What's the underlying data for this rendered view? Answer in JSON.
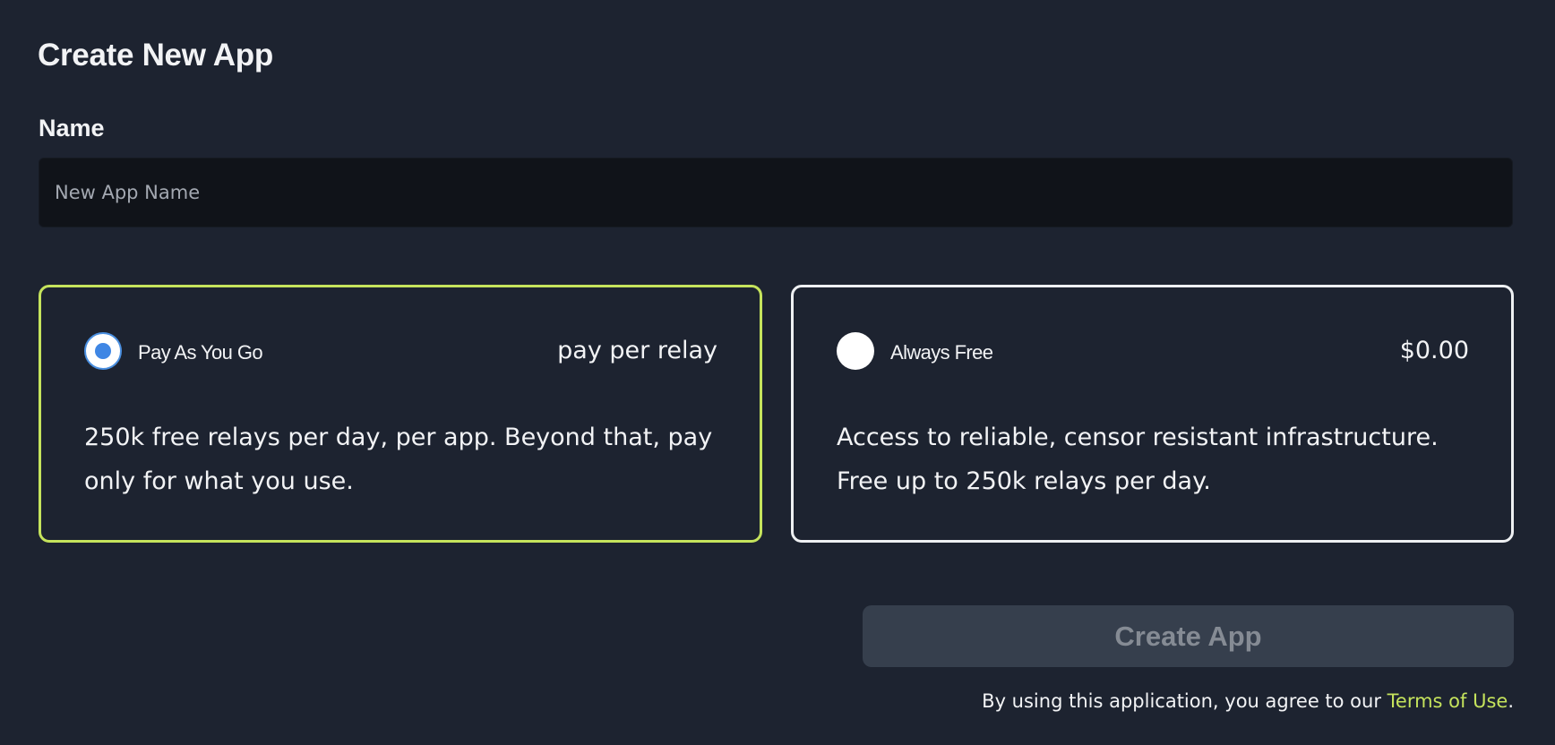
{
  "header": {
    "title": "Create New App"
  },
  "form": {
    "name_label": "Name",
    "name_value": "",
    "name_placeholder": "New App Name"
  },
  "plans": [
    {
      "name": "Pay As You Go",
      "price": "pay per relay",
      "description": "250k free relays per day, per app. Beyond that, pay only for what you use.",
      "selected": true
    },
    {
      "name": "Always Free",
      "price": "$0.00",
      "description": "Access to reliable, censor resistant infrastructure. Free up to 250k relays per day.",
      "selected": false
    }
  ],
  "actions": {
    "create_label": "Create App",
    "create_disabled": true
  },
  "footer": {
    "terms_prefix": "By using this application, you agree to our ",
    "terms_link": "Terms of Use",
    "terms_suffix": "."
  },
  "colors": {
    "background": "#1d2330",
    "input_background": "#101319",
    "accent": "#c5e35c",
    "radio_selected": "#3f86e4",
    "button_disabled_bg": "#363f4d",
    "button_disabled_text": "#858b94"
  }
}
